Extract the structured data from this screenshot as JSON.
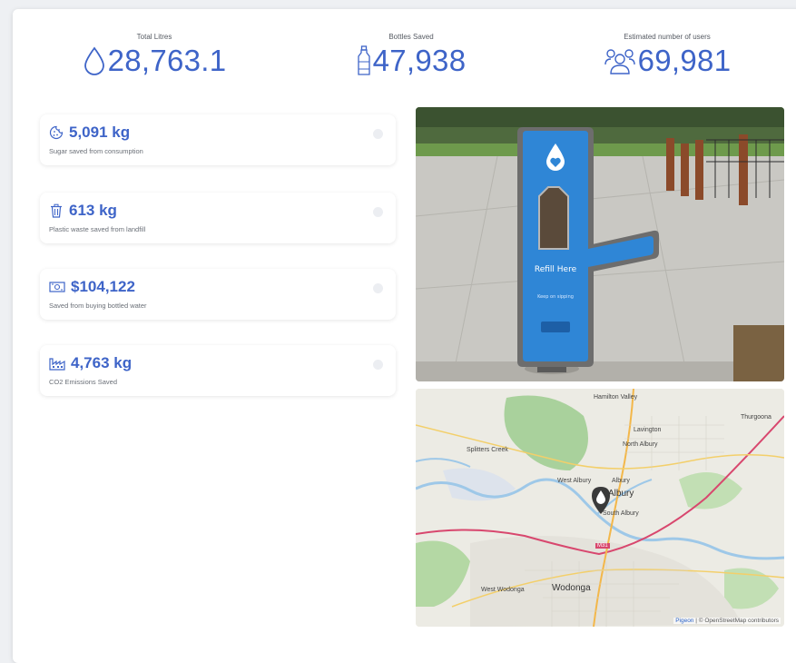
{
  "summary": [
    {
      "label": "Total Litres",
      "value": "28,763.1",
      "icon": "water-drop-icon"
    },
    {
      "label": "Bottles Saved",
      "value": "47,938",
      "icon": "bottle-icon"
    },
    {
      "label": "Estimated number of users",
      "value": "69,981",
      "icon": "users-icon"
    }
  ],
  "stats": [
    {
      "value": "5,091 kg",
      "desc": "Sugar saved from consumption",
      "icon": "cookie-icon"
    },
    {
      "value": "613 kg",
      "desc": "Plastic waste saved from landfill",
      "icon": "trash-bin-icon"
    },
    {
      "value": "$104,122",
      "desc": "Saved from buying bottled water",
      "icon": "banknote-icon"
    },
    {
      "value": "4,763 kg",
      "desc": "CO2 Emissions Saved",
      "icon": "factory-icon"
    }
  ],
  "photo": {
    "sign_text": "Refill Here",
    "sign_sub": "Keep on sipping"
  },
  "map": {
    "labels": [
      "Hamilton Valley",
      "Thurgoona",
      "Lavington",
      "North Albury",
      "Splitters Creek",
      "West Albury",
      "Albury",
      "Albury",
      "South Albury",
      "West Wodonga",
      "Wodonga",
      "M31"
    ],
    "attribution_link": "Pigeon",
    "attribution_text": "| © OpenStreetMap contributors"
  },
  "colors": {
    "accent": "#3e64c8",
    "water_blue": "#2f86d6"
  }
}
